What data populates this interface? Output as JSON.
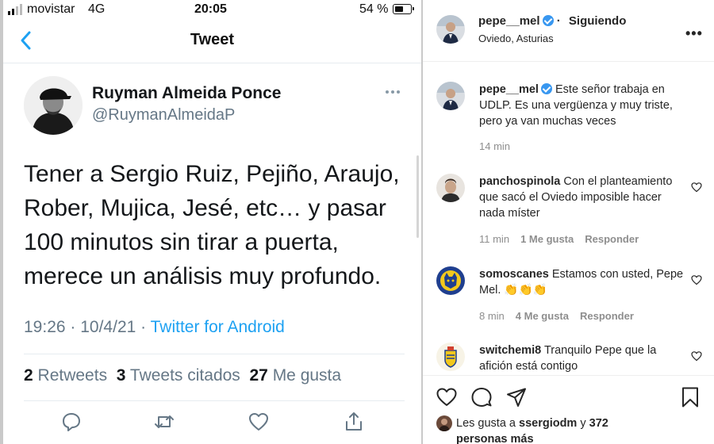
{
  "status_bar": {
    "carrier": "movistar",
    "network": "4G",
    "time": "20:05",
    "battery": "54 %",
    "battery_level": 0.54
  },
  "twitter": {
    "header_title": "Tweet",
    "author_name": "Ruyman Almeida Ponce",
    "author_handle": "@RuymanAlmeidaP",
    "tweet_text": "Tener a Sergio Ruiz, Pejiño, Araujo, Rober, Mujica, Jesé, etc… y pasar 100 minutos sin tirar a puerta, merece un análisis muy profundo.",
    "time": "19:26",
    "date": "10/4/21",
    "source": "Twitter for Android",
    "retweets_count": "2",
    "retweets_label": "Retweets",
    "quotes_count": "3",
    "quotes_label": "Tweets citados",
    "likes_count": "27",
    "likes_label": "Me gusta",
    "icons": [
      "back-chevron-icon",
      "more-icon",
      "reply-icon",
      "retweet-icon",
      "like-heart-icon",
      "share-icon"
    ]
  },
  "instagram": {
    "post_user": "pepe__mel",
    "follow_status": "Siguiendo",
    "location": "Oviedo, Asturias",
    "caption": {
      "user": "pepe__mel",
      "text": "Este señor trabaja en UDLP. Es una vergüenza y muy triste, pero ya van muchas veces",
      "time": "14 min"
    },
    "comments": [
      {
        "user": "panchospinola",
        "text": "Con el planteamiento que sacó el Oviedo imposible hacer nada míster",
        "time": "11 min",
        "likes": "1 Me gusta",
        "reply": "Responder"
      },
      {
        "user": "somoscanes",
        "text": "Estamos con usted, Pepe Mel. 👏👏👏",
        "time": "8 min",
        "likes": "4 Me gusta",
        "reply": "Responder"
      },
      {
        "user": "switchemi8",
        "text": "Tranquilo Pepe que la afición está contigo"
      }
    ],
    "likes_prefix": "Les gusta a ",
    "likes_user": "ssergiodm",
    "likes_joiner": " y ",
    "likes_others": "372 personas más",
    "icons": [
      "verified-badge-icon",
      "more-icon",
      "like-icon",
      "comment-icon",
      "send-icon",
      "bookmark-icon"
    ],
    "colors": {
      "verified": "#3897f0",
      "meta_text": "#8e8e8e"
    }
  }
}
